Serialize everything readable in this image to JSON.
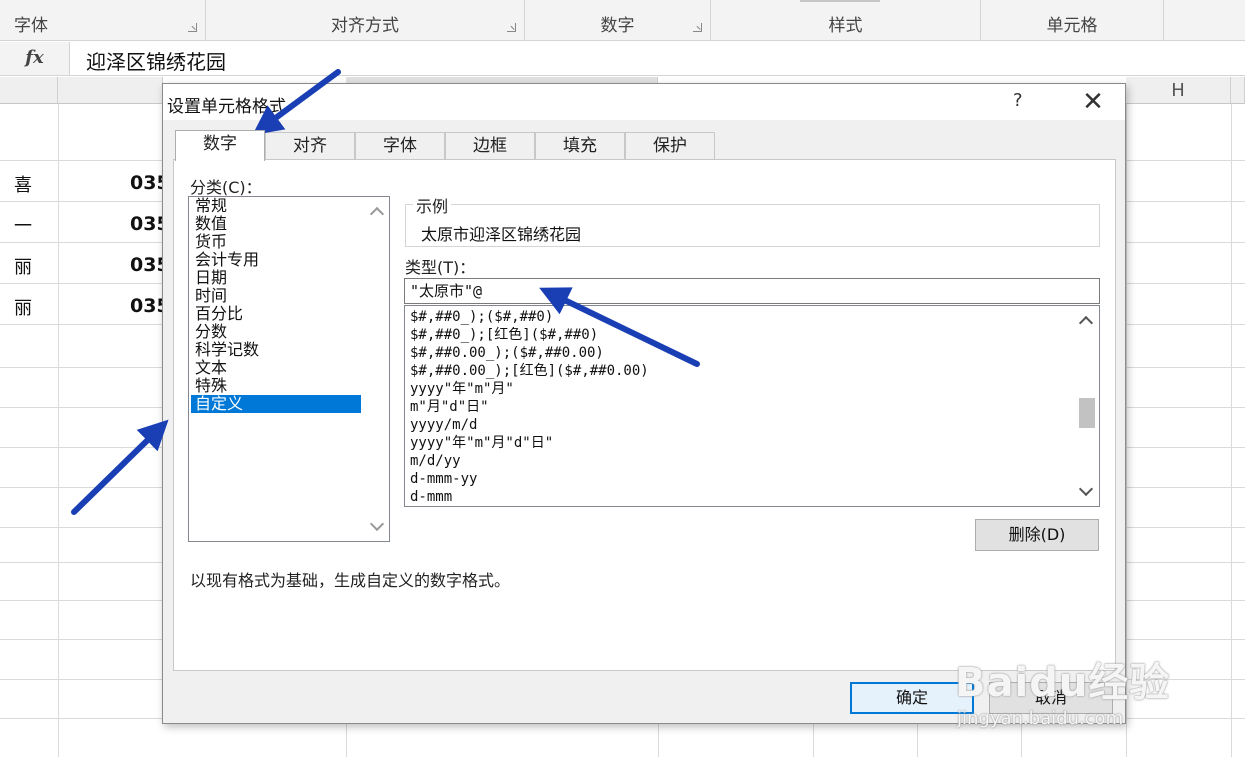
{
  "ribbon": {
    "groups": [
      "字体",
      "对齐方式",
      "数字",
      "样式",
      "单元格"
    ]
  },
  "formula_bar": {
    "fx_label": "fx",
    "content": "迎泽区锦绣花园"
  },
  "sheet": {
    "column_headers": [
      "H"
    ],
    "col_a": [
      "喜",
      "一",
      "丽",
      "丽"
    ],
    "col_b": [
      "035",
      "035",
      "035",
      "035"
    ]
  },
  "dialog": {
    "title": "设置单元格格式",
    "help": "?",
    "close": "✕",
    "tabs": [
      "数字",
      "对齐",
      "字体",
      "边框",
      "填充",
      "保护"
    ],
    "category_label": "分类(C)：",
    "categories": [
      "常规",
      "数值",
      "货币",
      "会计专用",
      "日期",
      "时间",
      "百分比",
      "分数",
      "科学记数",
      "文本",
      "特殊",
      "自定义"
    ],
    "selected_category": "自定义",
    "sample_label": "示例",
    "sample_value": "太原市迎泽区锦绣花园",
    "type_label": "类型(T)：",
    "type_value": "\"太原市\"@",
    "format_list": [
      "$#,##0_);($#,##0)",
      "$#,##0_);[红色]($#,##0)",
      "$#,##0.00_);($#,##0.00)",
      "$#,##0.00_);[红色]($#,##0.00)",
      "yyyy\"年\"m\"月\"",
      "m\"月\"d\"日\"",
      "yyyy/m/d",
      "yyyy\"年\"m\"月\"d\"日\"",
      "m/d/yy",
      "d-mmm-yy",
      "d-mmm"
    ],
    "delete_button": "删除(D)",
    "description": "以现有格式为基础，生成自定义的数字格式。",
    "ok_button": "确定",
    "cancel_button": "取消"
  },
  "watermark": {
    "brand": "Baidu经验",
    "url": "jingyan.baidu.com"
  },
  "colors": {
    "annotation_arrow": "#1a3fb5",
    "selection": "#0078d7"
  }
}
